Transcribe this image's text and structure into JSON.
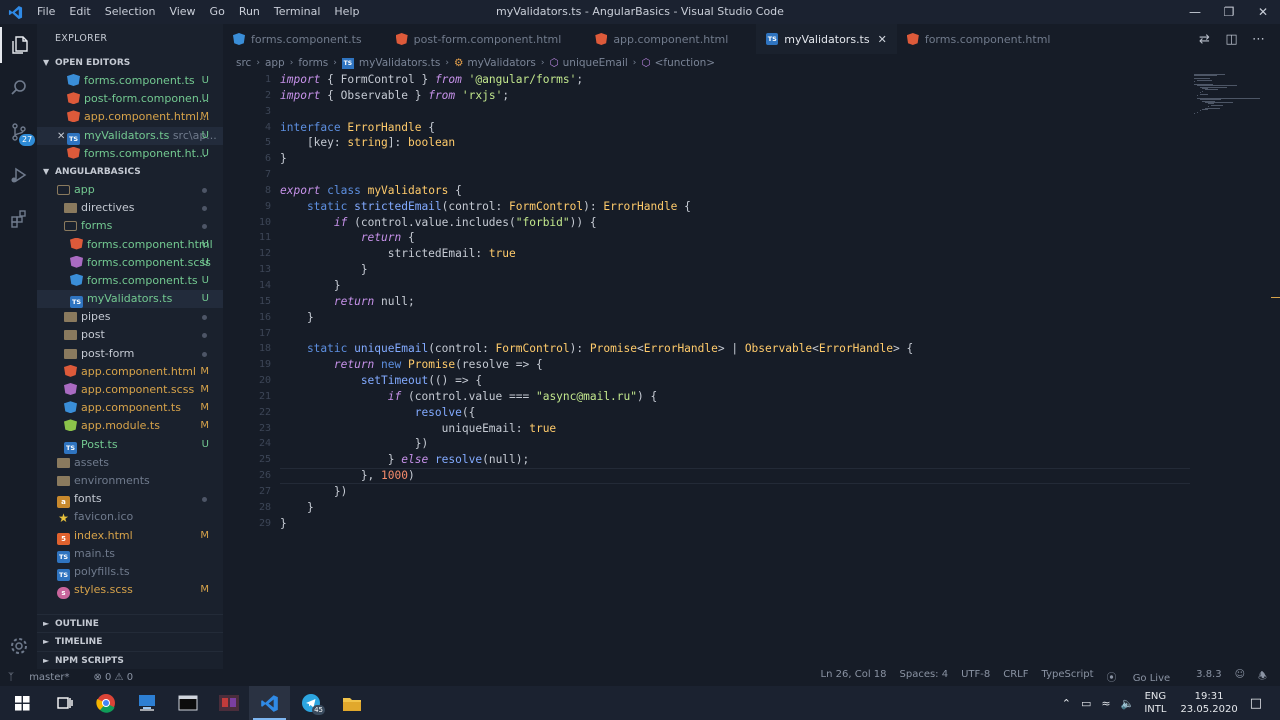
{
  "titlebar": {
    "menu": [
      "File",
      "Edit",
      "Selection",
      "View",
      "Go",
      "Run",
      "Terminal",
      "Help"
    ],
    "title": "myValidators.ts - AngularBasics - Visual Studio Code"
  },
  "activity": {
    "scm_badge": "27"
  },
  "sidebar": {
    "title": "EXPLORER",
    "open_editors_label": "OPEN EDITORS",
    "open_editors": [
      {
        "name": "forms.component.ts",
        "status": "U"
      },
      {
        "name": "post-form.componen...",
        "status": "U"
      },
      {
        "name": "app.component.html...",
        "status": "M"
      },
      {
        "name": "myValidators.ts",
        "hint": "src\\ap...",
        "status": "U"
      },
      {
        "name": "forms.component.ht...",
        "status": "U"
      }
    ],
    "project_label": "ANGULARBASICS",
    "tree": [
      {
        "name": "app"
      },
      {
        "name": "directives"
      },
      {
        "name": "forms"
      },
      {
        "name": "forms.component.html",
        "status": "U"
      },
      {
        "name": "forms.component.scss",
        "status": "U"
      },
      {
        "name": "forms.component.ts",
        "status": "U"
      },
      {
        "name": "myValidators.ts",
        "status": "U"
      },
      {
        "name": "pipes"
      },
      {
        "name": "post"
      },
      {
        "name": "post-form"
      },
      {
        "name": "app.component.html",
        "status": "M"
      },
      {
        "name": "app.component.scss",
        "status": "M"
      },
      {
        "name": "app.component.ts",
        "status": "M"
      },
      {
        "name": "app.module.ts",
        "status": "M"
      },
      {
        "name": "Post.ts",
        "status": "U"
      },
      {
        "name": "assets"
      },
      {
        "name": "environments"
      },
      {
        "name": "fonts"
      },
      {
        "name": "favicon.ico"
      },
      {
        "name": "index.html",
        "status": "M"
      },
      {
        "name": "main.ts"
      },
      {
        "name": "polyfills.ts"
      },
      {
        "name": "styles.scss",
        "status": "M"
      }
    ],
    "bottom_sections": [
      "OUTLINE",
      "TIMELINE",
      "NPM SCRIPTS"
    ]
  },
  "tabs": [
    {
      "label": "forms.component.ts",
      "icon": "TS"
    },
    {
      "label": "post-form.component.html"
    },
    {
      "label": "app.component.html"
    },
    {
      "label": "myValidators.ts",
      "icon": "TS"
    },
    {
      "label": "forms.component.html"
    }
  ],
  "breadcrumb": [
    "src",
    "app",
    "forms",
    "myValidators.ts",
    "myValidators",
    "uniqueEmail",
    "<function>"
  ],
  "editor": {
    "line_numbers": [
      "1",
      "2",
      "3",
      "4",
      "5",
      "6",
      "7",
      "8",
      "9",
      "10",
      "11",
      "12",
      "13",
      "14",
      "15",
      "16",
      "17",
      "18",
      "19",
      "20",
      "21",
      "22",
      "23",
      "24",
      "25",
      "26",
      "27",
      "28",
      "29"
    ],
    "current_line": 26
  },
  "statusbar": {
    "branch": "master*",
    "problems": "⊗ 0 ⚠ 0",
    "position": "Ln 26, Col 18",
    "spaces": "Spaces: 4",
    "encoding": "UTF-8",
    "eol": "CRLF",
    "language": "TypeScript",
    "golive": "Go Live",
    "version": "3.8.3"
  },
  "taskbar": {
    "lang_top": "ENG",
    "lang_bottom": "INTL",
    "time": "19:31",
    "date": "23.05.2020",
    "telegram_badge": "45"
  },
  "colors": {
    "keyword": "#5d8fe0",
    "control_keyword": "#c792ea",
    "string": "#c3e88d",
    "type": "#ffcb6b",
    "number": "#f78c6c"
  }
}
